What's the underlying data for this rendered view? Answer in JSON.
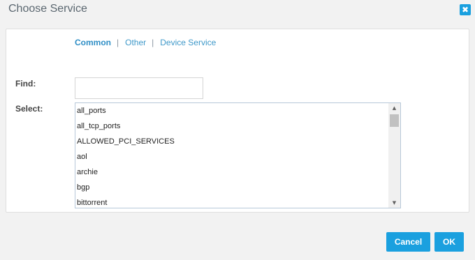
{
  "dialog": {
    "title": "Choose Service",
    "close_glyph": "✖",
    "close_icon": "close-icon"
  },
  "tabs": [
    {
      "label": "Common",
      "active": true
    },
    {
      "label": "Other",
      "active": false
    },
    {
      "label": "Device Service",
      "active": false
    }
  ],
  "tab_separator": "|",
  "find": {
    "label": "Find:",
    "value": "",
    "placeholder": ""
  },
  "select": {
    "label": "Select:",
    "items": [
      "all_ports",
      "all_tcp_ports",
      "ALLOWED_PCI_SERVICES",
      "aol",
      "archie",
      "bgp",
      "bittorrent"
    ],
    "scroll_up_glyph": "▲",
    "scroll_down_glyph": "▼"
  },
  "buttons": {
    "cancel": "Cancel",
    "ok": "OK"
  },
  "colors": {
    "accent": "#1aa0df",
    "tab_link": "#3e98c9"
  }
}
